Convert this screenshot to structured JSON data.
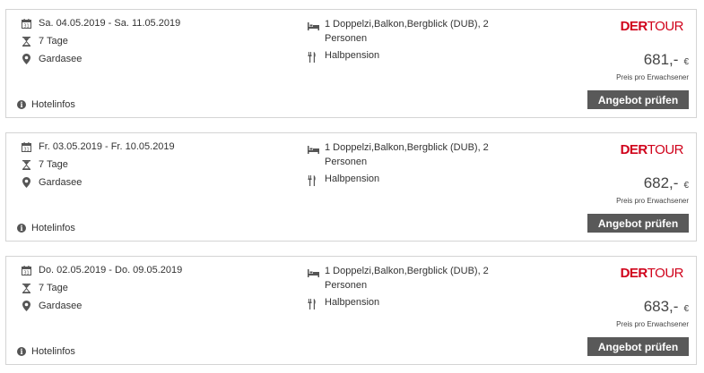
{
  "offers": [
    {
      "date_range": "Sa. 04.05.2019 - Sa. 11.05.2019",
      "duration": "7 Tage",
      "location": "Gardasee",
      "room": "1 Doppelzi,Balkon,Bergblick (DUB), 2 Personen",
      "board": "Halbpension",
      "brand_der": "DER",
      "brand_tour": "TOUR",
      "price": "681,-",
      "currency": "€",
      "price_note": "Preis pro Erwachsener",
      "cta": "Angebot prüfen",
      "hotelinfo": "Hotelinfos"
    },
    {
      "date_range": "Fr. 03.05.2019 - Fr. 10.05.2019",
      "duration": "7 Tage",
      "location": "Gardasee",
      "room": "1 Doppelzi,Balkon,Bergblick (DUB), 2 Personen",
      "board": "Halbpension",
      "brand_der": "DER",
      "brand_tour": "TOUR",
      "price": "682,-",
      "currency": "€",
      "price_note": "Preis pro Erwachsener",
      "cta": "Angebot prüfen",
      "hotelinfo": "Hotelinfos"
    },
    {
      "date_range": "Do. 02.05.2019 - Do. 09.05.2019",
      "duration": "7 Tage",
      "location": "Gardasee",
      "room": "1 Doppelzi,Balkon,Bergblick (DUB), 2 Personen",
      "board": "Halbpension",
      "brand_der": "DER",
      "brand_tour": "TOUR",
      "price": "683,-",
      "currency": "€",
      "price_note": "Preis pro Erwachsener",
      "cta": "Angebot prüfen",
      "hotelinfo": "Hotelinfos"
    }
  ],
  "icons": {
    "calendar": "calendar-icon",
    "duration": "hourglass-icon",
    "location": "map-pin-icon",
    "room": "bed-icon",
    "board": "cutlery-icon",
    "info": "info-icon"
  },
  "colors": {
    "brand": "#d0021b",
    "button": "#595959",
    "border": "#d4d4d4"
  }
}
